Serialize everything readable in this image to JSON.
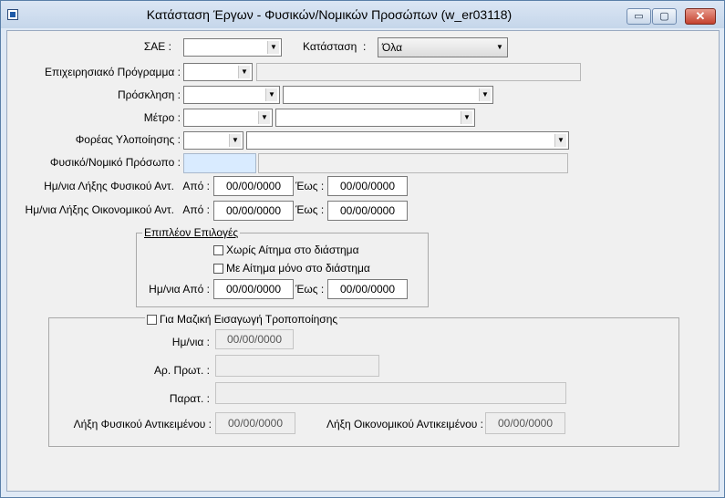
{
  "window": {
    "title": "Κατάσταση Έργων - Φυσικών/Νομικών Προσώπων   (w_er03118)",
    "controls": {
      "minimize": "▭",
      "maximize": "▢",
      "close": "✕"
    }
  },
  "form": {
    "sae_label": "ΣΑΕ",
    "status_label": "Κατάσταση",
    "status_value": "Όλα",
    "program_label": "Επιχειρησιακό Πρόγραμμα",
    "invitation_label": "Πρόσκληση",
    "measure_label": "Μέτρο",
    "agency_label": "Φορέας Υλοποίησης",
    "person_label": "Φυσικό/Νομικό Πρόσωπο",
    "physical_end_label": "Ημ/νια Λήξης Φυσικού Αντ.",
    "financial_end_label": "Ημ/νια Λήξης Οικονομικού Αντ.",
    "from_label": "Από",
    "to_label": "Έως",
    "colon": ":",
    "physical_from": "00/00/0000",
    "physical_to": "00/00/0000",
    "financial_from": "00/00/0000",
    "financial_to": "00/00/0000"
  },
  "extra": {
    "title": "Επιπλέον Επιλογές",
    "no_request": "Χωρίς Αίτημα στο διάστημα",
    "with_request": "Με Αίτημα μόνο στο διάστημα",
    "date_from_label": "Ημ/νια Από",
    "date_to_label": "Έως",
    "date_from": "00/00/0000",
    "date_to": "00/00/0000"
  },
  "bulk": {
    "title": "Για Μαζική Εισαγωγή Τροποποίησης",
    "date_label": "Ημ/νια",
    "date_value": "00/00/0000",
    "protocol_label": "Αρ. Πρωτ.",
    "notes_label": "Παρατ.",
    "physical_label": "Λήξη Φυσικού Αντικειμένου",
    "physical_value": "00/00/0000",
    "financial_label": "Λήξη Οικονομικού Αντικειμένου",
    "financial_value": "00/00/0000"
  },
  "icons": {
    "dropdown": "▼"
  }
}
